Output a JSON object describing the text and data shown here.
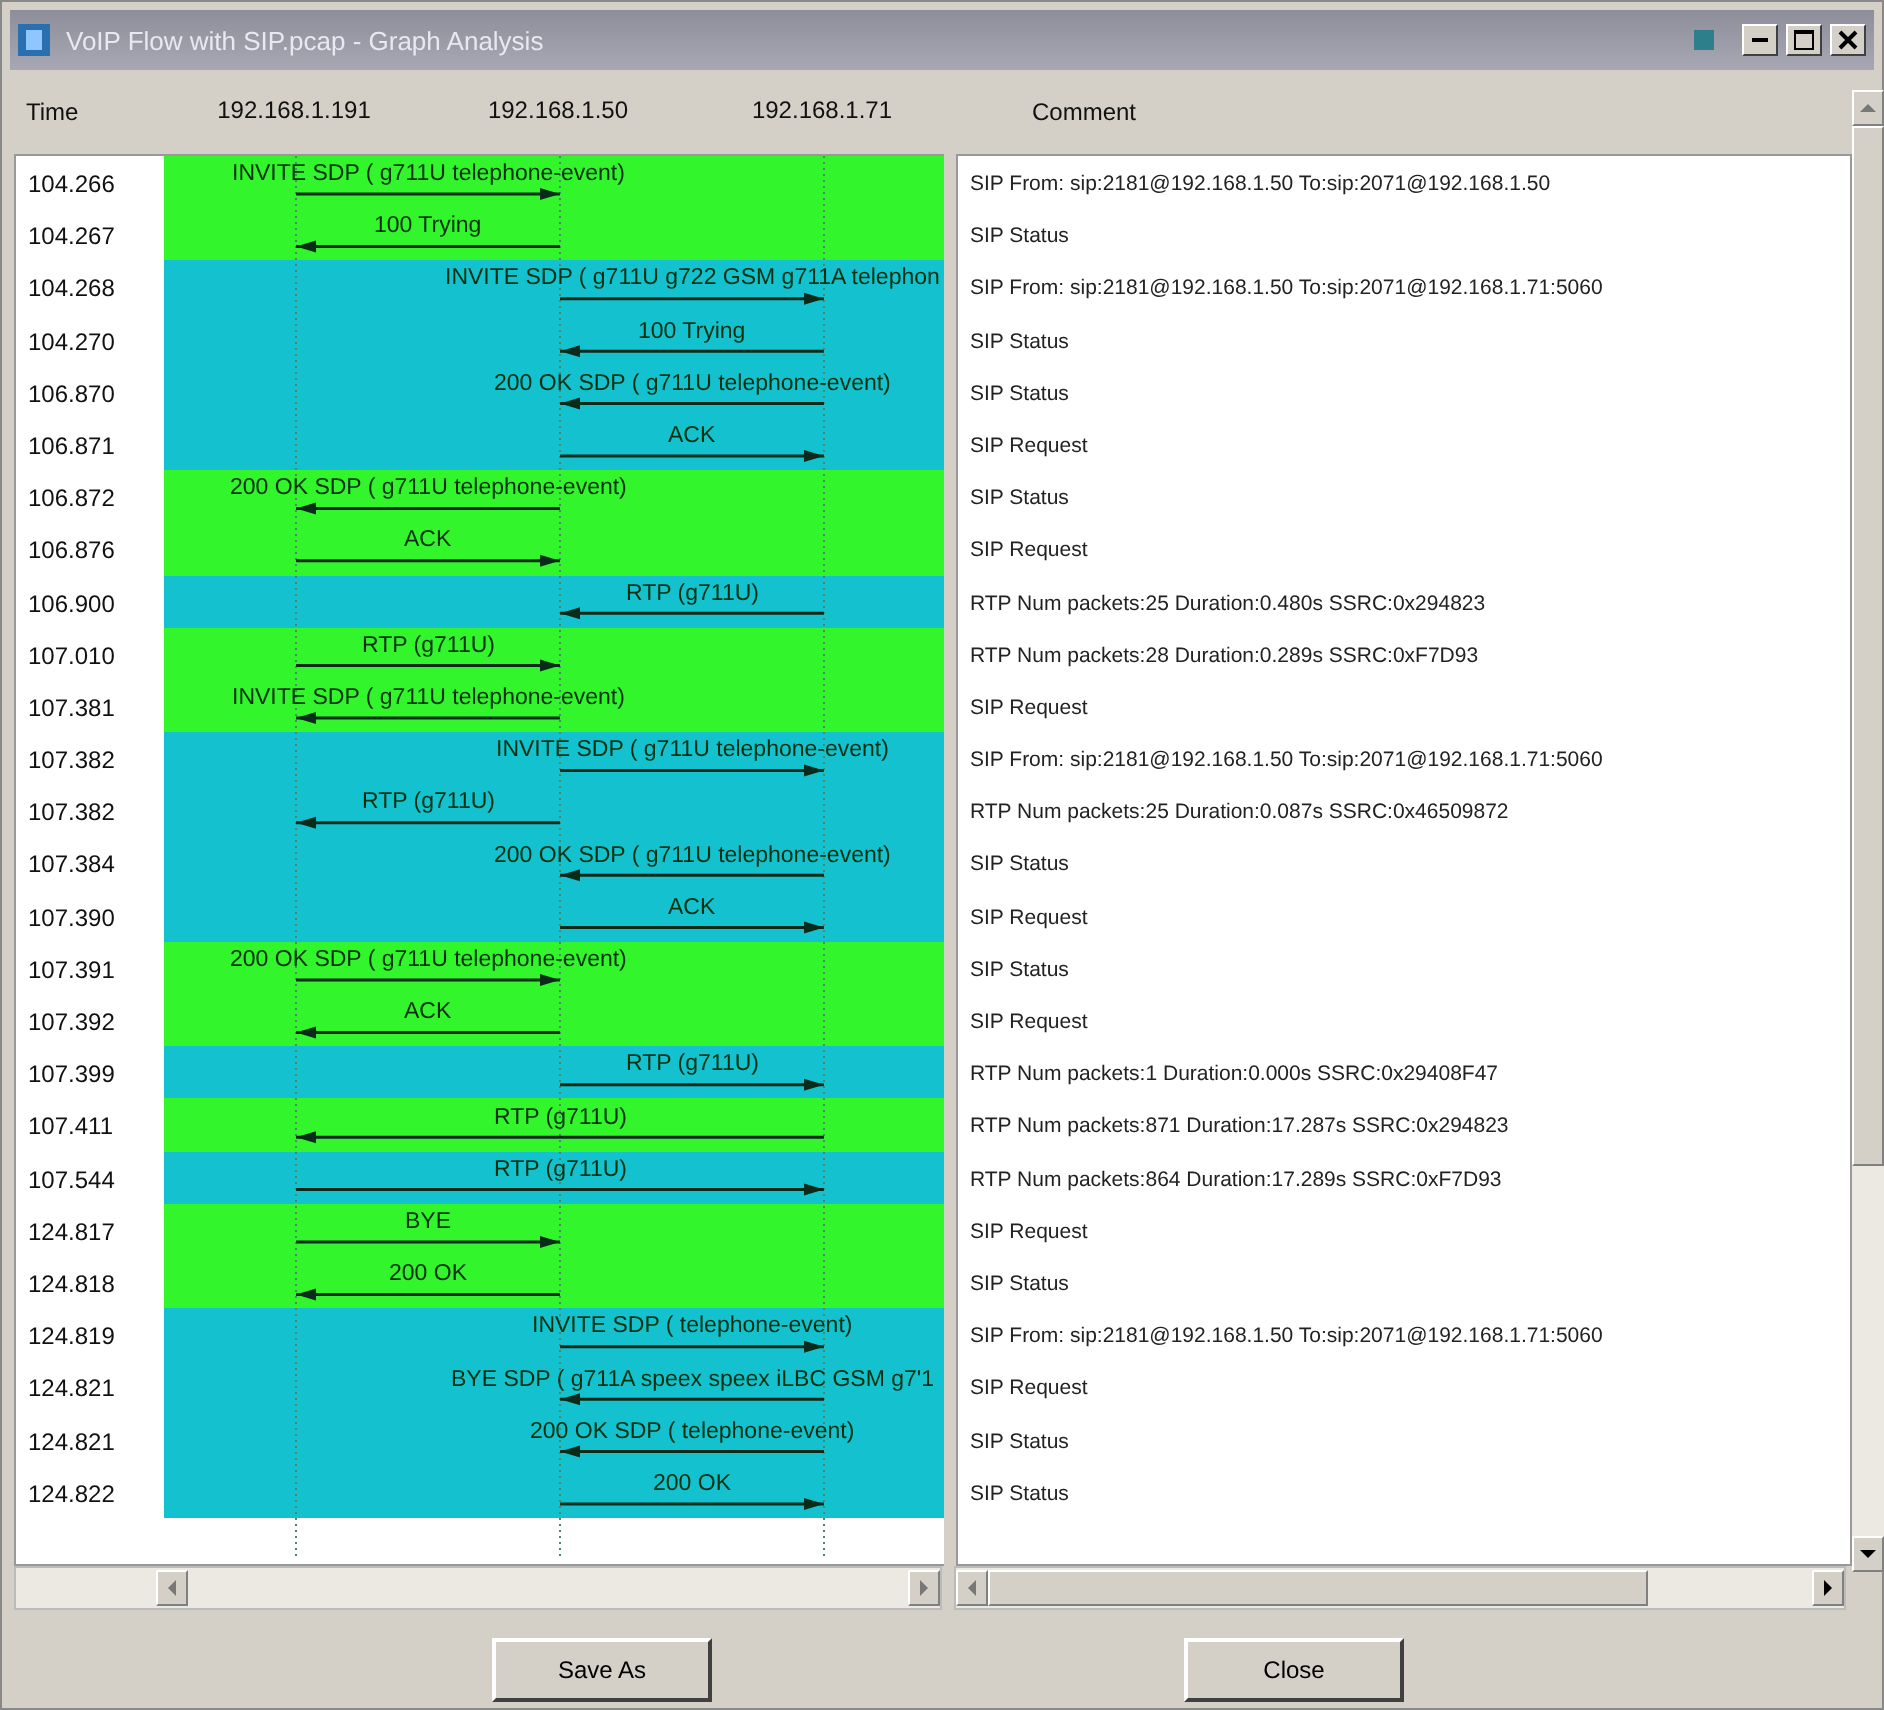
{
  "window": {
    "title": "VoIP Flow with SIP.pcap - Graph Analysis"
  },
  "header": {
    "time": "Time",
    "nodes": [
      "192.168.1.191",
      "192.168.1.50",
      "192.168.1.71"
    ],
    "comment": "Comment"
  },
  "rows": [
    {
      "time": "104.266",
      "label": "INVITE SDP ( g711U telephone-event)",
      "kind": "ab",
      "color": "#33f52c",
      "comment": "SIP From: sip:2181@192.168.1.50 To:sip:2071@192.168.1.50"
    },
    {
      "time": "104.267",
      "label": "100 Trying",
      "kind": "ba",
      "color": "#33f52c",
      "comment": "SIP Status"
    },
    {
      "time": "104.268",
      "label": "INVITE SDP ( g711U g722 GSM g711A telephon",
      "kind": "bc",
      "color": "#14c2cf",
      "comment": "SIP From: sip:2181@192.168.1.50 To:sip:2071@192.168.1.71:5060"
    },
    {
      "time": "104.270",
      "label": "100 Trying",
      "kind": "cb",
      "color": "#14c2cf",
      "comment": "SIP Status"
    },
    {
      "time": "106.870",
      "label": "200 OK SDP ( g711U telephone-event)",
      "kind": "cb",
      "color": "#14c2cf",
      "comment": "SIP Status"
    },
    {
      "time": "106.871",
      "label": "ACK",
      "kind": "bc",
      "color": "#14c2cf",
      "comment": "SIP Request"
    },
    {
      "time": "106.872",
      "label": "200 OK SDP ( g711U telephone-event)",
      "kind": "ba",
      "color": "#33f52c",
      "comment": "SIP Status"
    },
    {
      "time": "106.876",
      "label": "ACK",
      "kind": "ab",
      "color": "#33f52c",
      "comment": "SIP Request"
    },
    {
      "time": "106.900",
      "label": "RTP (g711U)",
      "kind": "cb",
      "color": "#14c2cf",
      "comment": "RTP Num packets:25  Duration:0.480s SSRC:0x294823"
    },
    {
      "time": "107.010",
      "label": "RTP (g711U)",
      "kind": "ab",
      "color": "#33f52c",
      "comment": "RTP Num packets:28  Duration:0.289s SSRC:0xF7D93"
    },
    {
      "time": "107.381",
      "label": "INVITE SDP ( g711U telephone-event)",
      "kind": "ba",
      "color": "#33f52c",
      "comment": "SIP Request"
    },
    {
      "time": "107.382",
      "label": "INVITE SDP ( g711U telephone-event)",
      "kind": "bc",
      "color": "#14c2cf",
      "comment": "SIP From: sip:2181@192.168.1.50 To:sip:2071@192.168.1.71:5060"
    },
    {
      "time": "107.382",
      "label": "RTP (g711U)",
      "kind": "ba",
      "color": "#14c2cf",
      "comment": "RTP Num packets:25  Duration:0.087s SSRC:0x46509872"
    },
    {
      "time": "107.384",
      "label": "200 OK SDP ( g711U telephone-event)",
      "kind": "cb",
      "color": "#14c2cf",
      "comment": "SIP Status"
    },
    {
      "time": "107.390",
      "label": "ACK",
      "kind": "bc",
      "color": "#14c2cf",
      "comment": "SIP Request"
    },
    {
      "time": "107.391",
      "label": "200 OK SDP ( g711U telephone-event)",
      "kind": "ab",
      "color": "#33f52c",
      "comment": "SIP Status"
    },
    {
      "time": "107.392",
      "label": "ACK",
      "kind": "ba",
      "color": "#33f52c",
      "comment": "SIP Request"
    },
    {
      "time": "107.399",
      "label": "RTP (g711U)",
      "kind": "bc",
      "color": "#14c2cf",
      "comment": "RTP Num packets:1  Duration:0.000s SSRC:0x29408F47"
    },
    {
      "time": "107.411",
      "label": "RTP (g711U)",
      "kind": "ca",
      "color": "#33f52c",
      "comment": "RTP Num packets:871  Duration:17.287s SSRC:0x294823"
    },
    {
      "time": "107.544",
      "label": "RTP (g711U)",
      "kind": "ac",
      "color": "#14c2cf",
      "comment": "RTP Num packets:864  Duration:17.289s SSRC:0xF7D93"
    },
    {
      "time": "124.817",
      "label": "BYE",
      "kind": "ab",
      "color": "#33f52c",
      "comment": "SIP Request"
    },
    {
      "time": "124.818",
      "label": "200 OK",
      "kind": "ba",
      "color": "#33f52c",
      "comment": "SIP Status"
    },
    {
      "time": "124.819",
      "label": "INVITE SDP ( telephone-event)",
      "kind": "bc",
      "color": "#14c2cf",
      "comment": "SIP From: sip:2181@192.168.1.50 To:sip:2071@192.168.1.71:5060"
    },
    {
      "time": "124.821",
      "label": "BYE SDP ( g711A speex speex iLBC GSM g7'1",
      "kind": "cb",
      "color": "#14c2cf",
      "comment": "SIP Request"
    },
    {
      "time": "124.821",
      "label": "200 OK SDP ( telephone-event)",
      "kind": "cb",
      "color": "#14c2cf",
      "comment": "SIP Status"
    },
    {
      "time": "124.822",
      "label": "200 OK",
      "kind": "bc",
      "color": "#14c2cf",
      "comment": "SIP Status"
    }
  ],
  "buttons": [
    "Save As",
    "Close"
  ]
}
